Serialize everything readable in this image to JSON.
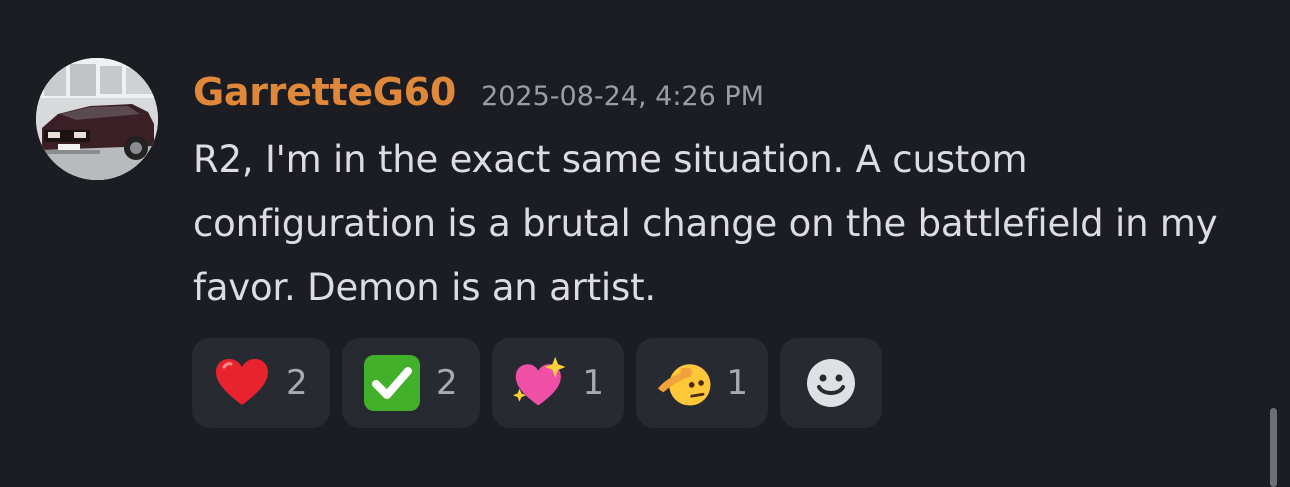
{
  "message": {
    "author": "GarretteG60",
    "author_color": "#e0883a",
    "timestamp": "2025-08-24, 4:26 PM",
    "content": "R2, I'm in the exact same situation. A custom configuration is a brutal change on the battlefield in my favor. Demon is an artist.",
    "avatar_icon": "car-photo-avatar"
  },
  "reactions": [
    {
      "emoji": "red-heart",
      "count": "2"
    },
    {
      "emoji": "check-mark-button",
      "count": "2"
    },
    {
      "emoji": "sparkling-heart",
      "count": "1"
    },
    {
      "emoji": "saluting-face",
      "count": "1"
    }
  ],
  "add_reaction_icon": "smiley-add-icon",
  "colors": {
    "background": "#1c1d22",
    "chip": "#282a31",
    "text": "#dcdde2",
    "muted": "#9a9ca6"
  }
}
